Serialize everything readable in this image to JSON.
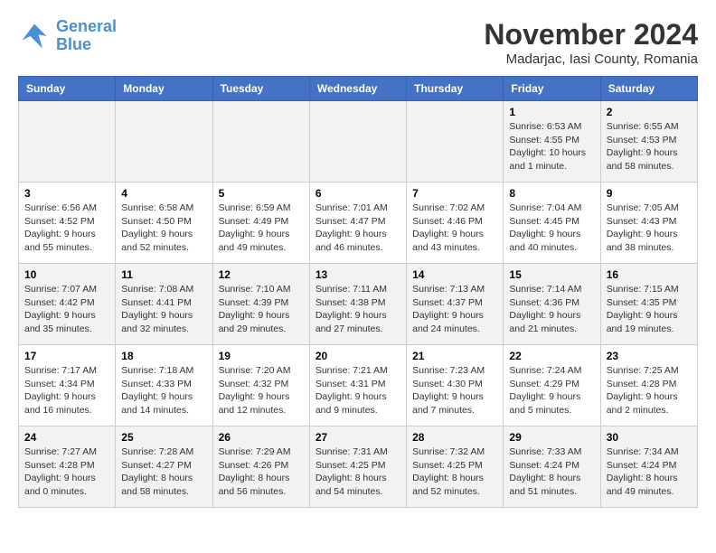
{
  "logo": {
    "line1": "General",
    "line2": "Blue"
  },
  "title": "November 2024",
  "location": "Madarjac, Iasi County, Romania",
  "weekdays": [
    "Sunday",
    "Monday",
    "Tuesday",
    "Wednesday",
    "Thursday",
    "Friday",
    "Saturday"
  ],
  "weeks": [
    [
      {
        "day": "",
        "info": ""
      },
      {
        "day": "",
        "info": ""
      },
      {
        "day": "",
        "info": ""
      },
      {
        "day": "",
        "info": ""
      },
      {
        "day": "",
        "info": ""
      },
      {
        "day": "1",
        "info": "Sunrise: 6:53 AM\nSunset: 4:55 PM\nDaylight: 10 hours and 1 minute."
      },
      {
        "day": "2",
        "info": "Sunrise: 6:55 AM\nSunset: 4:53 PM\nDaylight: 9 hours and 58 minutes."
      }
    ],
    [
      {
        "day": "3",
        "info": "Sunrise: 6:56 AM\nSunset: 4:52 PM\nDaylight: 9 hours and 55 minutes."
      },
      {
        "day": "4",
        "info": "Sunrise: 6:58 AM\nSunset: 4:50 PM\nDaylight: 9 hours and 52 minutes."
      },
      {
        "day": "5",
        "info": "Sunrise: 6:59 AM\nSunset: 4:49 PM\nDaylight: 9 hours and 49 minutes."
      },
      {
        "day": "6",
        "info": "Sunrise: 7:01 AM\nSunset: 4:47 PM\nDaylight: 9 hours and 46 minutes."
      },
      {
        "day": "7",
        "info": "Sunrise: 7:02 AM\nSunset: 4:46 PM\nDaylight: 9 hours and 43 minutes."
      },
      {
        "day": "8",
        "info": "Sunrise: 7:04 AM\nSunset: 4:45 PM\nDaylight: 9 hours and 40 minutes."
      },
      {
        "day": "9",
        "info": "Sunrise: 7:05 AM\nSunset: 4:43 PM\nDaylight: 9 hours and 38 minutes."
      }
    ],
    [
      {
        "day": "10",
        "info": "Sunrise: 7:07 AM\nSunset: 4:42 PM\nDaylight: 9 hours and 35 minutes."
      },
      {
        "day": "11",
        "info": "Sunrise: 7:08 AM\nSunset: 4:41 PM\nDaylight: 9 hours and 32 minutes."
      },
      {
        "day": "12",
        "info": "Sunrise: 7:10 AM\nSunset: 4:39 PM\nDaylight: 9 hours and 29 minutes."
      },
      {
        "day": "13",
        "info": "Sunrise: 7:11 AM\nSunset: 4:38 PM\nDaylight: 9 hours and 27 minutes."
      },
      {
        "day": "14",
        "info": "Sunrise: 7:13 AM\nSunset: 4:37 PM\nDaylight: 9 hours and 24 minutes."
      },
      {
        "day": "15",
        "info": "Sunrise: 7:14 AM\nSunset: 4:36 PM\nDaylight: 9 hours and 21 minutes."
      },
      {
        "day": "16",
        "info": "Sunrise: 7:15 AM\nSunset: 4:35 PM\nDaylight: 9 hours and 19 minutes."
      }
    ],
    [
      {
        "day": "17",
        "info": "Sunrise: 7:17 AM\nSunset: 4:34 PM\nDaylight: 9 hours and 16 minutes."
      },
      {
        "day": "18",
        "info": "Sunrise: 7:18 AM\nSunset: 4:33 PM\nDaylight: 9 hours and 14 minutes."
      },
      {
        "day": "19",
        "info": "Sunrise: 7:20 AM\nSunset: 4:32 PM\nDaylight: 9 hours and 12 minutes."
      },
      {
        "day": "20",
        "info": "Sunrise: 7:21 AM\nSunset: 4:31 PM\nDaylight: 9 hours and 9 minutes."
      },
      {
        "day": "21",
        "info": "Sunrise: 7:23 AM\nSunset: 4:30 PM\nDaylight: 9 hours and 7 minutes."
      },
      {
        "day": "22",
        "info": "Sunrise: 7:24 AM\nSunset: 4:29 PM\nDaylight: 9 hours and 5 minutes."
      },
      {
        "day": "23",
        "info": "Sunrise: 7:25 AM\nSunset: 4:28 PM\nDaylight: 9 hours and 2 minutes."
      }
    ],
    [
      {
        "day": "24",
        "info": "Sunrise: 7:27 AM\nSunset: 4:28 PM\nDaylight: 9 hours and 0 minutes."
      },
      {
        "day": "25",
        "info": "Sunrise: 7:28 AM\nSunset: 4:27 PM\nDaylight: 8 hours and 58 minutes."
      },
      {
        "day": "26",
        "info": "Sunrise: 7:29 AM\nSunset: 4:26 PM\nDaylight: 8 hours and 56 minutes."
      },
      {
        "day": "27",
        "info": "Sunrise: 7:31 AM\nSunset: 4:25 PM\nDaylight: 8 hours and 54 minutes."
      },
      {
        "day": "28",
        "info": "Sunrise: 7:32 AM\nSunset: 4:25 PM\nDaylight: 8 hours and 52 minutes."
      },
      {
        "day": "29",
        "info": "Sunrise: 7:33 AM\nSunset: 4:24 PM\nDaylight: 8 hours and 51 minutes."
      },
      {
        "day": "30",
        "info": "Sunrise: 7:34 AM\nSunset: 4:24 PM\nDaylight: 8 hours and 49 minutes."
      }
    ]
  ]
}
